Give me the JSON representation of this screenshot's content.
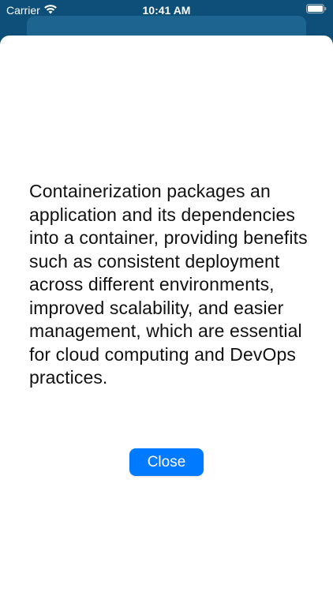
{
  "status_bar": {
    "carrier": "Carrier",
    "time": "10:41 AM",
    "icons": [
      "wifi-icon",
      "battery-icon"
    ]
  },
  "sheet": {
    "message": "Containerization packages an application and its dependencies into a container, providing benefits such as consistent deployment across different environments, improved scalability, and easier management, which are essential for cloud computing and DevOps practices.",
    "close_label": "Close"
  },
  "colors": {
    "background": "#0d4f78",
    "sheet": "#ffffff",
    "accent": "#007aff",
    "text": "#111111"
  }
}
